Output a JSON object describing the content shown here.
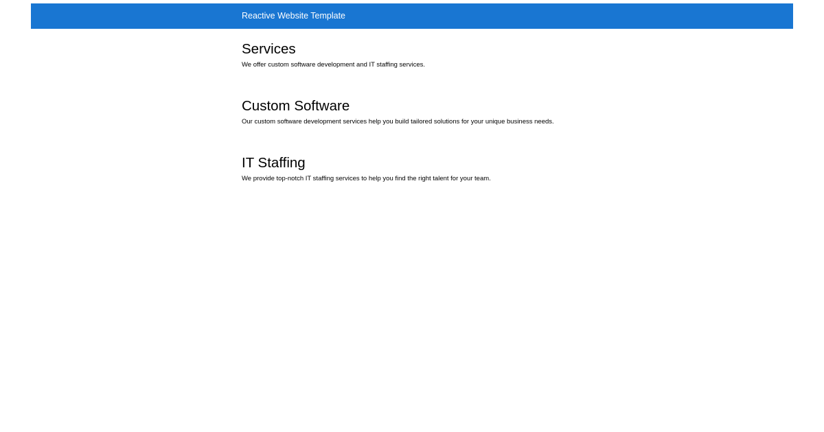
{
  "header": {
    "title": "Reactive Website Template",
    "background_color": "#1976d2"
  },
  "sections": [
    {
      "heading": "Services",
      "text": "We offer custom software development and IT staffing services."
    },
    {
      "heading": "Custom Software",
      "text": "Our custom software development services help you build tailored solutions for your unique business needs."
    },
    {
      "heading": "IT Staffing",
      "text": "We provide top-notch IT staffing services to help you find the right talent for your team."
    }
  ]
}
